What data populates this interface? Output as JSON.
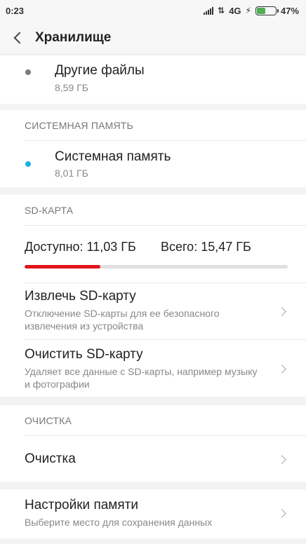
{
  "status_bar": {
    "time": "0:23",
    "network": "4G",
    "battery_percent": "47%",
    "battery_level": 0.47,
    "icons": [
      "signal-icon",
      "data-arrows-icon",
      "charging-icon",
      "battery-icon"
    ]
  },
  "header": {
    "title": "Хранилище",
    "back_icon": "back-arrow-icon"
  },
  "other_files": {
    "name": "Другие файлы",
    "size": "8,59 ГБ",
    "dot_color": "#777c86"
  },
  "system_memory": {
    "section_title": "СИСТЕМНАЯ ПАМЯТЬ",
    "name": "Системная память",
    "size": "8,01 ГБ",
    "dot_color": "#1ab0e8"
  },
  "sd_card": {
    "section_title": "SD-КАРТА",
    "available": "Доступно: 11,03 ГБ",
    "total": "Всего: 15,47 ГБ",
    "used_fraction": 0.287,
    "bar_color": "#e2141b",
    "items": [
      {
        "title": "Извлечь SD-карту",
        "subtitle": "Отключение SD-карты для ее безопасного извлечения из устройства"
      },
      {
        "title": "Очистить SD-карту",
        "subtitle": "Удаляет все данные с SD-карты, например музыку и фотографии"
      }
    ]
  },
  "cleanup": {
    "section_title": "ОЧИСТКА",
    "item_title": "Очистка"
  },
  "memory_settings": {
    "title": "Настройки памяти",
    "subtitle": "Выберите место для сохранения данных"
  }
}
